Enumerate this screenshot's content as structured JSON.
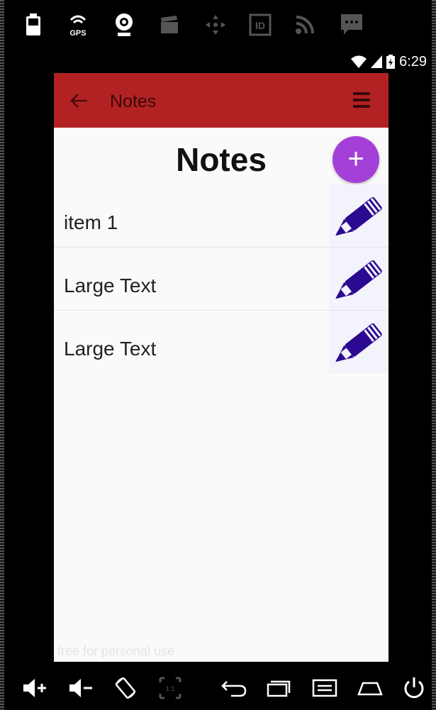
{
  "status_bar": {
    "time": "6:29"
  },
  "emulator": {
    "gps_label": "GPS",
    "id_label": "ID"
  },
  "app_bar": {
    "title": "Notes"
  },
  "page": {
    "heading": "Notes",
    "fab_symbol": "+"
  },
  "notes": [
    {
      "label": "item 1"
    },
    {
      "label": "Large Text"
    },
    {
      "label": "Large Text"
    }
  ],
  "watermark": "free for personal use",
  "colors": {
    "app_bar": "#b22222",
    "fab": "#a43fd8",
    "pencil": "#2b0a91",
    "screen_bg": "#fafafa"
  },
  "icons": {
    "toolbar": [
      "battery-icon",
      "gps-icon",
      "webcam-icon",
      "movie-clapper-icon",
      "dpad-icon",
      "id-icon",
      "rss-icon",
      "message-icon"
    ],
    "nav": [
      "volume-up-icon",
      "volume-down-icon",
      "rotate-icon",
      "scale-icon",
      "back-icon",
      "recent-apps-icon",
      "menu-icon",
      "home-icon",
      "power-icon"
    ]
  }
}
